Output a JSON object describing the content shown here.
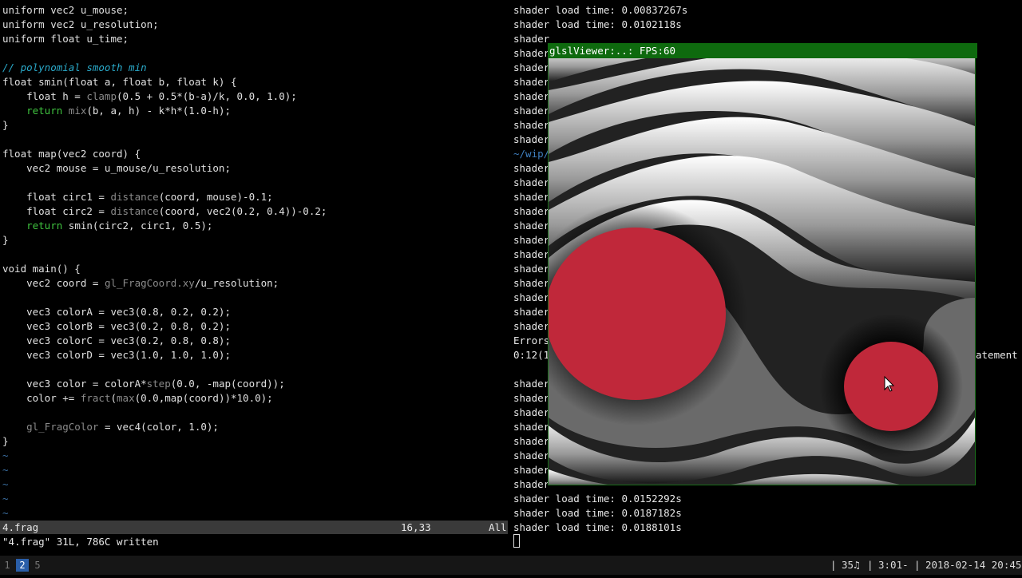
{
  "editor": {
    "lines": [
      [
        {
          "c": "k",
          "t": "uniform vec2 u_mouse;"
        }
      ],
      [
        {
          "c": "k",
          "t": "uniform vec2 u_resolution;"
        }
      ],
      [
        {
          "c": "k",
          "t": "uniform float u_time;"
        }
      ],
      [],
      [
        {
          "c": "cm",
          "t": "// polynomial smooth min"
        }
      ],
      [
        {
          "c": "k",
          "t": "float smin(float a, float b, float k) {"
        }
      ],
      [
        {
          "c": "k",
          "t": "    float h = "
        },
        {
          "c": "fn",
          "t": "clamp"
        },
        {
          "c": "k",
          "t": "(0.5 + 0.5*(b-a)/k, 0.0, 1.0);"
        }
      ],
      [
        {
          "c": "kw",
          "t": "    return "
        },
        {
          "c": "fn",
          "t": "mix"
        },
        {
          "c": "k",
          "t": "(b, a, h) - k*h*(1.0-h);"
        }
      ],
      [
        {
          "c": "k",
          "t": "}"
        }
      ],
      [],
      [
        {
          "c": "k",
          "t": "float map(vec2 coord) {"
        }
      ],
      [
        {
          "c": "k",
          "t": "    vec2 mouse = u_mouse/u_resolution;"
        }
      ],
      [],
      [
        {
          "c": "k",
          "t": "    float circ1 = "
        },
        {
          "c": "fn",
          "t": "distance"
        },
        {
          "c": "k",
          "t": "(coord, mouse)-0.1;"
        }
      ],
      [
        {
          "c": "k",
          "t": "    float circ2 = "
        },
        {
          "c": "fn",
          "t": "distance"
        },
        {
          "c": "k",
          "t": "(coord, vec2(0.2, 0.4))-0.2;"
        }
      ],
      [
        {
          "c": "kw",
          "t": "    return "
        },
        {
          "c": "k",
          "t": "smin(circ2, circ1, 0.5);"
        }
      ],
      [
        {
          "c": "k",
          "t": "}"
        }
      ],
      [],
      [
        {
          "c": "k",
          "t": "void main() {"
        }
      ],
      [
        {
          "c": "k",
          "t": "    vec2 coord = "
        },
        {
          "c": "fn",
          "t": "gl_FragCoord.xy"
        },
        {
          "c": "k",
          "t": "/u_resolution;"
        }
      ],
      [],
      [
        {
          "c": "k",
          "t": "    vec3 colorA = vec3(0.8, 0.2, 0.2);"
        }
      ],
      [
        {
          "c": "k",
          "t": "    vec3 colorB = vec3(0.2, 0.8, 0.2);"
        }
      ],
      [
        {
          "c": "k",
          "t": "    vec3 colorC = vec3(0.2, 0.8, 0.8);"
        }
      ],
      [
        {
          "c": "k",
          "t": "    vec3 colorD = vec3(1.0, 1.0, 1.0);"
        }
      ],
      [],
      [
        {
          "c": "k",
          "t": "    vec3 color = colorA*"
        },
        {
          "c": "fn",
          "t": "step"
        },
        {
          "c": "k",
          "t": "(0.0, -map(coord));"
        }
      ],
      [
        {
          "c": "k",
          "t": "    color += "
        },
        {
          "c": "fn",
          "t": "fract"
        },
        {
          "c": "k",
          "t": "("
        },
        {
          "c": "fn",
          "t": "max"
        },
        {
          "c": "k",
          "t": "(0.0,map(coord))*10.0);"
        }
      ],
      [],
      [
        {
          "c": "fn",
          "t": "    gl_FragColor"
        },
        {
          "c": "k",
          "t": " = vec4(color, 1.0);"
        }
      ],
      [
        {
          "c": "k",
          "t": "}"
        }
      ],
      [
        {
          "c": "tilde",
          "t": "~"
        }
      ],
      [
        {
          "c": "tilde",
          "t": "~"
        }
      ],
      [
        {
          "c": "tilde",
          "t": "~"
        }
      ],
      [
        {
          "c": "tilde",
          "t": "~"
        }
      ],
      [
        {
          "c": "tilde",
          "t": "~"
        }
      ]
    ],
    "status": {
      "filename": "4.frag",
      "position": "16,33",
      "scroll": "All"
    },
    "message": "\"4.frag\" 31L, 786C written"
  },
  "terminal": {
    "lines": [
      "shader load time: 0.00837267s",
      "shader load time: 0.0102118s",
      "shader",
      "shader",
      "shader",
      "shader",
      "shader",
      "shader",
      "shader",
      "shader",
      "~/wip/",
      "shader",
      "shader",
      "shader",
      "shader",
      "shader",
      "shader",
      "shader",
      "shader",
      "shader",
      "shader",
      "shader",
      "shader",
      "Errors",
      "0:12(1",
      "",
      "shader",
      "shader",
      "shader",
      "shader",
      "shader",
      "shader",
      "shader",
      "shader",
      "shader load time: 0.0152292s",
      "shader load time: 0.0187182s",
      "shader load time: 0.0188101s"
    ],
    "dir_line_index": 10,
    "stray_text": "atement"
  },
  "viewer": {
    "title": "glslViewer:..: FPS:60",
    "colors": {
      "blob": "#c0283a",
      "border": "#1a6e1a"
    },
    "cursor_icon": "arrow-pointer-icon"
  },
  "taskbar": {
    "workspaces": [
      "1",
      "2",
      "5"
    ],
    "active_workspace": "2",
    "volume": "35♫",
    "battery": "3:01-",
    "datetime": "2018-02-14 20:45"
  }
}
